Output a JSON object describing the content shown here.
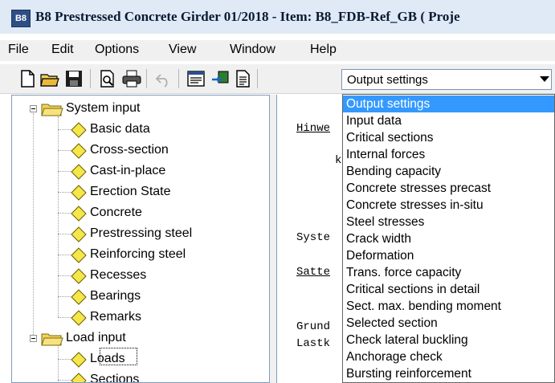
{
  "window": {
    "icon_text": "B8",
    "title": "B8 Prestressed Concrete Girder  01/2018 - Item: B8_FDB-Ref_GB ( Proje"
  },
  "menu": [
    "File",
    "Edit",
    "Options",
    "View",
    "Window",
    "Help"
  ],
  "toolbar": {
    "buttons": [
      "new-file-icon",
      "open-folder-icon",
      "save-icon",
      "print-preview-icon",
      "print-icon",
      "undo-icon",
      "form-icon",
      "import-icon",
      "document-icon"
    ],
    "combo_value": "Output settings"
  },
  "tree": {
    "groups": [
      {
        "label": "System input",
        "items": [
          "Basic data",
          "Cross-section",
          "Cast-in-place",
          "Erection State",
          "Concrete",
          "Prestressing steel",
          "Reinforcing steel",
          "Recesses",
          "Bearings",
          "Remarks"
        ]
      },
      {
        "label": "Load input",
        "items": [
          "Loads",
          "Sections"
        ]
      }
    ],
    "selected_item": "Loads"
  },
  "content": {
    "lines": [
      "Hinwe",
      "k",
      "Syste",
      "Satte",
      "Grund",
      "Lastk"
    ]
  },
  "dropdown": {
    "options": [
      "Output settings",
      "Input data",
      "Critical sections",
      "Internal forces",
      "Bending capacity",
      "Concrete stresses precast",
      "Concrete stresses in-situ",
      "Steel stresses",
      "Crack width",
      "Deformation",
      "Trans. force capacity",
      "Critical sections in detail",
      "Sect. max. bending moment",
      "Selected section",
      "Check lateral buckling",
      "Anchorage check",
      "Bursting reinforcement"
    ],
    "selected": "Output settings"
  },
  "colors": {
    "selection": "#3399ff",
    "titlebar": "#dfeaf6",
    "diamond": "#f5e64a"
  }
}
